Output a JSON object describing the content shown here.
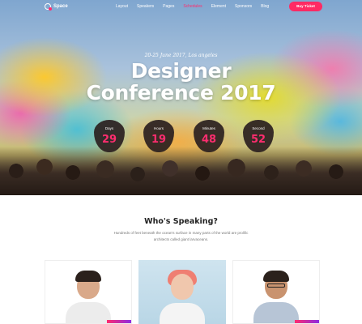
{
  "nav": {
    "logo_text": "Space",
    "items": [
      {
        "label": "Layout"
      },
      {
        "label": "Speakers"
      },
      {
        "label": "Pages"
      },
      {
        "label": "Schedules"
      },
      {
        "label": "Element"
      },
      {
        "label": "Sponsors"
      },
      {
        "label": "Blog"
      }
    ],
    "active_item": "Schedules",
    "cta_label": "Buy Ticket"
  },
  "hero": {
    "date_location": "20-25 June 2017, Los angeles",
    "title_line1": "Designer",
    "title_line2": "Conference 2017",
    "countdown": [
      {
        "label": "Days",
        "value": "29"
      },
      {
        "label": "Hours",
        "value": "19"
      },
      {
        "label": "Minutes",
        "value": "48"
      },
      {
        "label": "Second",
        "value": "52"
      }
    ]
  },
  "speakers": {
    "title": "Who's Speaking?",
    "description": "Hundreds of feet beneath the ocean's surface in many parts of the world are prolific architects called giant larvaceans."
  },
  "colors": {
    "accent": "#ff2d6f",
    "counter_bg": "#2a1f1f",
    "heading": "#222222"
  }
}
